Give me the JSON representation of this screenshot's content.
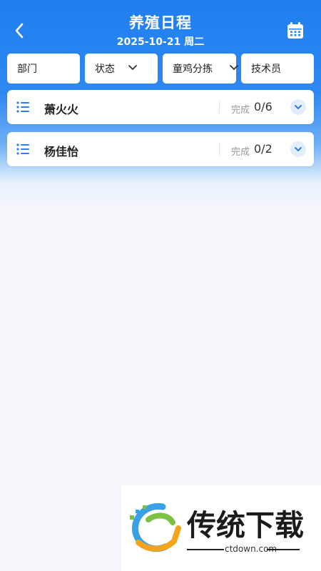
{
  "header": {
    "title": "养殖日程",
    "date": "2025-10-21 周二",
    "back_icon": "chevron-left-icon",
    "calendar_icon": "calendar-icon"
  },
  "filters": [
    {
      "label": "部门",
      "has_dropdown": false
    },
    {
      "label": "状态",
      "has_dropdown": true
    },
    {
      "label": "童鸡分拣",
      "has_dropdown": true
    },
    {
      "label": "技术员",
      "has_dropdown": false
    }
  ],
  "technicians": [
    {
      "name": "萧火火",
      "status_label": "完成",
      "progress": "0/6"
    },
    {
      "name": "杨佳怡",
      "status_label": "完成",
      "progress": "0/2"
    }
  ],
  "watermark": {
    "brand": "传统下载",
    "url": "ctdown.com"
  },
  "colors": {
    "primary": "#1f7ff0",
    "icon_blue": "#2f7de9",
    "badge_bg": "#e3eefc"
  }
}
